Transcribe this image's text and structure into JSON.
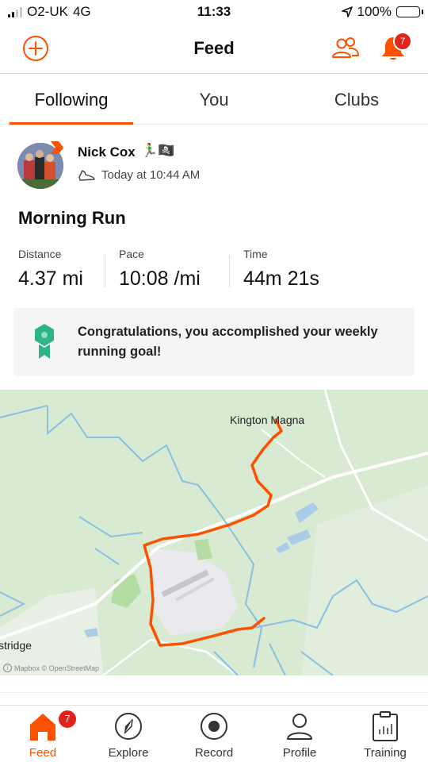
{
  "status_bar": {
    "carrier": "O2-UK",
    "network": "4G",
    "time": "11:33",
    "battery": "100%"
  },
  "header": {
    "title": "Feed",
    "notification_count": "7"
  },
  "tabs": [
    {
      "label": "Following",
      "active": true
    },
    {
      "label": "You",
      "active": false
    },
    {
      "label": "Clubs",
      "active": false
    }
  ],
  "activity": {
    "athlete_name": "Nick Cox",
    "athlete_emojis": "🏃‍♂️🏴‍☠️",
    "timestamp": "Today at 10:44 AM",
    "title": "Morning Run",
    "stats": [
      {
        "label": "Distance",
        "value": "4.37 mi"
      },
      {
        "label": "Pace",
        "value": "10:08 /mi"
      },
      {
        "label": "Time",
        "value": "44m 21s"
      }
    ],
    "goal_message": "Congratulations, you accomplished your weekly running goal!"
  },
  "map": {
    "place_labels": [
      "Kington Magna",
      "stridge"
    ],
    "attribution": "Mapbox © OpenStreetMap"
  },
  "bottom_nav": [
    {
      "label": "Feed",
      "active": true,
      "icon": "home-icon",
      "badge": "7"
    },
    {
      "label": "Explore",
      "active": false,
      "icon": "compass-icon"
    },
    {
      "label": "Record",
      "active": false,
      "icon": "record-icon"
    },
    {
      "label": "Profile",
      "active": false,
      "icon": "profile-icon"
    },
    {
      "label": "Training",
      "active": false,
      "icon": "training-icon"
    }
  ],
  "colors": {
    "accent": "#fc5200",
    "badge": "#e0241b",
    "goal_badge": "#2fb585",
    "map_land": "#d8ead2",
    "route": "#fc5200"
  }
}
